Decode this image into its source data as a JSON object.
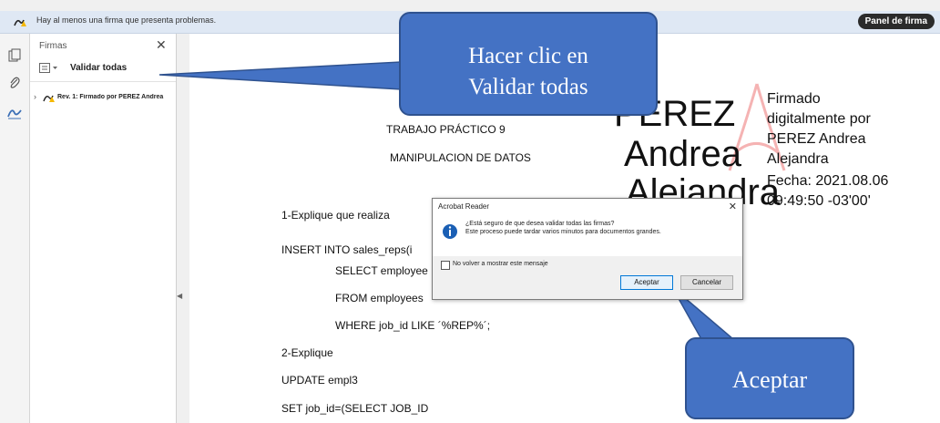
{
  "message_bar": {
    "text": "Hay al menos una firma que presenta problemas.",
    "panel_button": "Panel de firma"
  },
  "sig_panel": {
    "title": "Firmas",
    "close": "✕",
    "validate_all": "Validar todas",
    "revision": "Rev. 1: Firmado por PEREZ Andrea"
  },
  "document": {
    "heading1": "TRABAJO PRÁCTICO 9",
    "heading2": "MANIPULACION DE DATOS",
    "lines": [
      "1-Explique  que realiza",
      "INSERT INTO sales_reps(i",
      "SELECT employee",
      "FROM employees",
      "WHERE job_id LIKE ´%REP%´;",
      "2-Explique",
      "UPDATE empl3",
      "SET   job_id=(SELECT JOB_ID"
    ],
    "signature": {
      "name_lines": [
        "PEREZ",
        "Andrea",
        "Alejandra"
      ],
      "details": [
        "Firmado",
        "digitalmente por",
        "PEREZ Andrea",
        "Alejandra",
        "Fecha: 2021.08.06",
        "09:49:50 -03'00'"
      ]
    }
  },
  "dialog": {
    "title": "Acrobat Reader",
    "close": "✕",
    "message_line1": "¿Está seguro de que desea validar todas las firmas?",
    "message_line2": "Este proceso puede tardar varios minutos para documentos grandes.",
    "checkbox_label": "No volver a mostrar este mensaje",
    "ok": "Aceptar",
    "cancel": "Cancelar"
  },
  "callouts": {
    "top_line1": "Hacer clic en",
    "top_line2": "Validar todas",
    "bottom": "Aceptar"
  },
  "colors": {
    "callout": "#4472c4",
    "msgbar": "#dfe8f4"
  }
}
